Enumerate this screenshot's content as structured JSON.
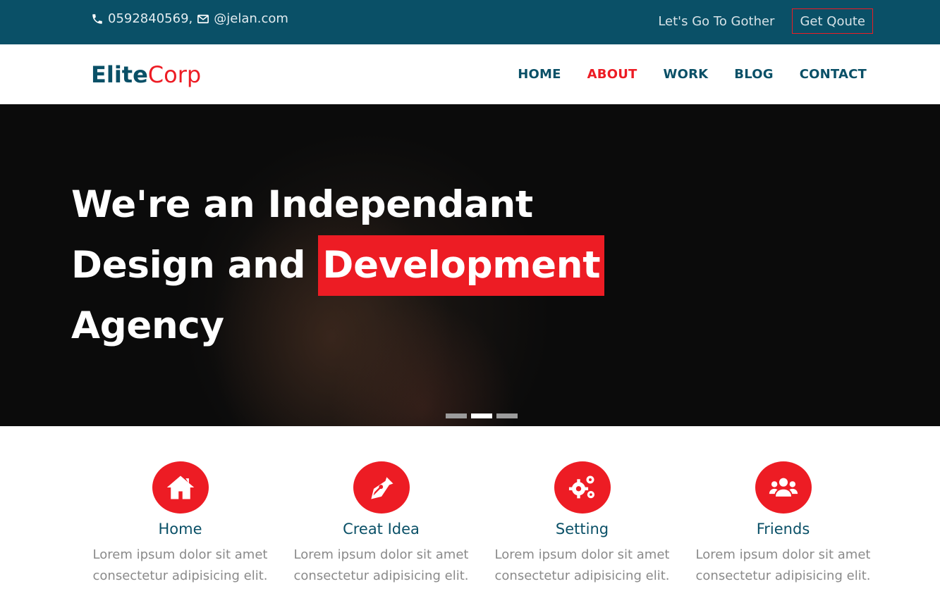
{
  "topbar": {
    "phone": "0592840569,",
    "email": "@jelan.com",
    "tagline": "Let's Go To Gother",
    "quote_label": "Get Qoute",
    "icons": {
      "phone": "phone-icon",
      "email": "envelope-icon"
    }
  },
  "brand": {
    "part1": "Elite",
    "part2": "Corp"
  },
  "nav": {
    "items": [
      {
        "label": "HOME"
      },
      {
        "label": "ABOUT",
        "active": true
      },
      {
        "label": "WORK"
      },
      {
        "label": "BLOG"
      },
      {
        "label": "CONTACT"
      }
    ]
  },
  "hero": {
    "line1": "We're an Independant",
    "line2_pre": "Design and",
    "line2_highlight": "Development",
    "line3": "Agency",
    "slides": 3,
    "active_slide": 2
  },
  "features": [
    {
      "icon": "home-icon",
      "title": "Home",
      "text1": "Lorem ipsum dolor sit amet",
      "text2": "consectetur adipisicing elit."
    },
    {
      "icon": "pen-nib-icon",
      "title": "Creat Idea",
      "text1": "Lorem ipsum dolor sit amet",
      "text2": "consectetur adipisicing elit."
    },
    {
      "icon": "gears-icon",
      "title": "Setting",
      "text1": "Lorem ipsum dolor sit amet",
      "text2": "consectetur adipisicing elit."
    },
    {
      "icon": "users-icon",
      "title": "Friends",
      "text1": "Lorem ipsum dolor sit amet",
      "text2": "consectetur adipisicing elit."
    }
  ],
  "colors": {
    "primary": "#0a5067",
    "accent": "#ed1c24",
    "hero_bg": "#0b0b0b",
    "muted_text": "#8a8a8a"
  }
}
